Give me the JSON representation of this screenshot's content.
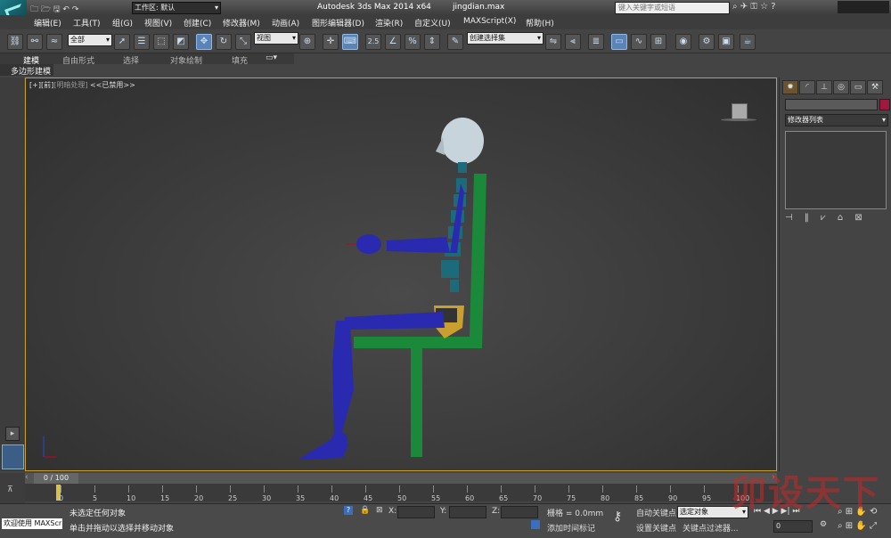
{
  "titlebar": {
    "workspace_label": "工作区: 默认",
    "app_title": "Autodesk 3ds Max  2014 x64",
    "file_name": "jingdian.max",
    "search_placeholder": "键入关键字或短语"
  },
  "menu": {
    "items": [
      "编辑(E)",
      "工具(T)",
      "组(G)",
      "视图(V)",
      "创建(C)",
      "修改器(M)",
      "动画(A)",
      "图形编辑器(D)",
      "渲染(R)",
      "自定义(U)",
      "MAXScript(X)",
      "帮助(H)"
    ]
  },
  "toolbar": {
    "selection_filter": "全部",
    "reference_coord": "视图",
    "snap_value": "2.5",
    "named_selection": "创建选择集"
  },
  "ribbon": {
    "tabs": [
      "建模",
      "自由形式",
      "选择",
      "对象绘制",
      "填充"
    ],
    "sub_label": "多边形建模"
  },
  "viewport": {
    "label_plus": "[+]",
    "label_view": "[前]",
    "label_shading": "[明暗处理]",
    "label_disabled": "<<已禁用>>"
  },
  "command_panel": {
    "modifier_list": "修改器列表"
  },
  "timeline": {
    "frame_counter": "0 / 100",
    "ticks": [
      "0",
      "5",
      "10",
      "15",
      "20",
      "25",
      "30",
      "35",
      "40",
      "45",
      "50",
      "55",
      "60",
      "65",
      "70",
      "75",
      "80",
      "85",
      "90",
      "95",
      "100"
    ]
  },
  "status": {
    "welcome": "欢迎使用 MAXScr",
    "selection": "未选定任何对象",
    "prompt": "单击并拖动以选择并移动对象",
    "x_label": "X:",
    "y_label": "Y:",
    "z_label": "Z:",
    "grid": "栅格 = 0.0mm",
    "add_time_tag": "添加时间标记",
    "auto_key": "自动关键点",
    "set_key": "设置关键点",
    "key_mode": "选定对象",
    "key_filters": "关键点过滤器...",
    "frame_value": "0"
  },
  "watermark": "卯设天下",
  "colors": {
    "viewport_border": "#c8a028",
    "figure_blue": "#2a2ab0",
    "spine_teal": "#1c6a7a",
    "chair_green": "#1a8a3a",
    "head_white": "#c8d4dc"
  }
}
